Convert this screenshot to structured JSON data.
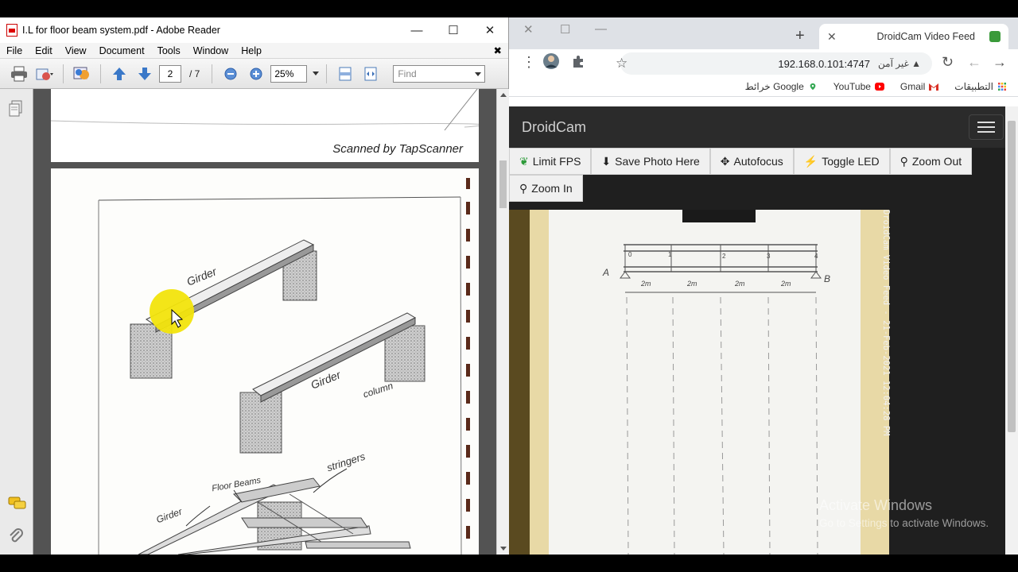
{
  "reader": {
    "window_title": "I.L for floor beam system.pdf - Adobe Reader",
    "menu": [
      "File",
      "Edit",
      "View",
      "Document",
      "Tools",
      "Window",
      "Help"
    ],
    "page_current": "2",
    "page_total": "/ 7",
    "zoom": "25%",
    "find_placeholder": "Find",
    "page1_footer": "Scanned by TapScanner",
    "sketch_labels": {
      "girder_top": "Girder",
      "girder_mid": "Girder",
      "column": "column",
      "floor_beams": "Floor Beams",
      "stringers": "stringers",
      "girder_bottom": "Girder"
    }
  },
  "chrome": {
    "tab_title": "DroidCam Video Feed",
    "address": "192.168.0.101:4747",
    "security_label": "غير آمن",
    "bookmarks": [
      "التطبيقات",
      "Gmail",
      "YouTube",
      "خرائط Google"
    ],
    "droidcam": {
      "brand": "DroidCam",
      "buttons": [
        "Limit FPS",
        "Save Photo Here",
        "Autofocus",
        "Toggle LED",
        "Zoom Out",
        "Zoom In"
      ],
      "stamp": "DroidCam Video Feed - 21-Feb-2021 12:04:28 PM",
      "paper_labels": {
        "a": "A",
        "b": "B",
        "spans": [
          "2m",
          "2m",
          "2m",
          "2m"
        ],
        "nodes": [
          "0",
          "1",
          "2",
          "3",
          "4"
        ]
      }
    }
  },
  "windows_notice": {
    "title": "Activate Windows",
    "subtitle": "Go to Settings to activate Windows."
  }
}
